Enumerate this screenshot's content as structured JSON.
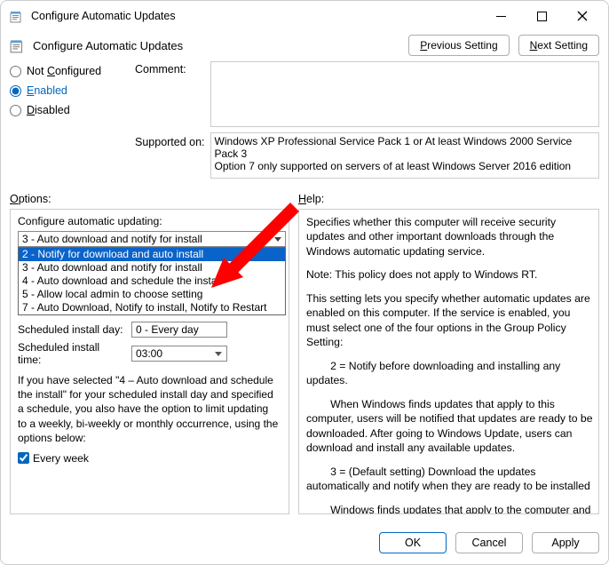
{
  "titlebar": {
    "title": "Configure Automatic Updates"
  },
  "header": {
    "title": "Configure Automatic Updates"
  },
  "nav": {
    "previous": "Previous Setting",
    "next": "Next Setting"
  },
  "state": {
    "radios": {
      "not_configured": "Not Configured",
      "enabled": "Enabled",
      "disabled": "Disabled"
    },
    "selected": "enabled"
  },
  "comment": {
    "label": "Comment:",
    "value": ""
  },
  "supported": {
    "label": "Supported on:",
    "value": "Windows XP Professional Service Pack 1 or At least Windows 2000 Service Pack 3\nOption 7 only supported on servers of at least Windows Server 2016 edition"
  },
  "section_labels": {
    "options": "Options:",
    "help": "Help:"
  },
  "options": {
    "heading": "Configure automatic updating:",
    "selected_display": "3 - Auto download and notify for install",
    "dropdown_highlight_index": 0,
    "dropdown_items": [
      "2 - Notify for download and auto install",
      "3 - Auto download and notify for install",
      "4 - Auto download and schedule the install",
      "5 - Allow local admin to choose setting",
      "7 - Auto Download, Notify to install, Notify to Restart"
    ],
    "sched_day_label": "Scheduled install day: ",
    "sched_day_value": "0 - Every day",
    "sched_time_label": "Scheduled install time:",
    "sched_time_value": "03:00",
    "blurb": "If you have selected \"4 – Auto download and schedule the install\" for your scheduled install day and specified a schedule, you also have the option to limit updating to a weekly, bi-weekly or monthly occurrence, using the options below:",
    "recurrence_label": "Every week",
    "recurrence_checked": true
  },
  "help": {
    "p1": "Specifies whether this computer will receive security updates and other important downloads through the Windows automatic updating service.",
    "p2": "Note: This policy does not apply to Windows RT.",
    "p3": "This setting lets you specify whether automatic updates are enabled on this computer. If the service is enabled, you must select one of the four options in the Group Policy Setting:",
    "p4": "        2 = Notify before downloading and installing any updates.",
    "p5": "        When Windows finds updates that apply to this computer, users will be notified that updates are ready to be downloaded. After going to Windows Update, users can download and install any available updates.",
    "p6": "        3 = (Default setting) Download the updates automatically and notify when they are ready to be installed",
    "p7": "        Windows finds updates that apply to the computer and downloads them in the background (the user is not notified"
  },
  "footer": {
    "ok": "OK",
    "cancel": "Cancel",
    "apply": "Apply"
  }
}
